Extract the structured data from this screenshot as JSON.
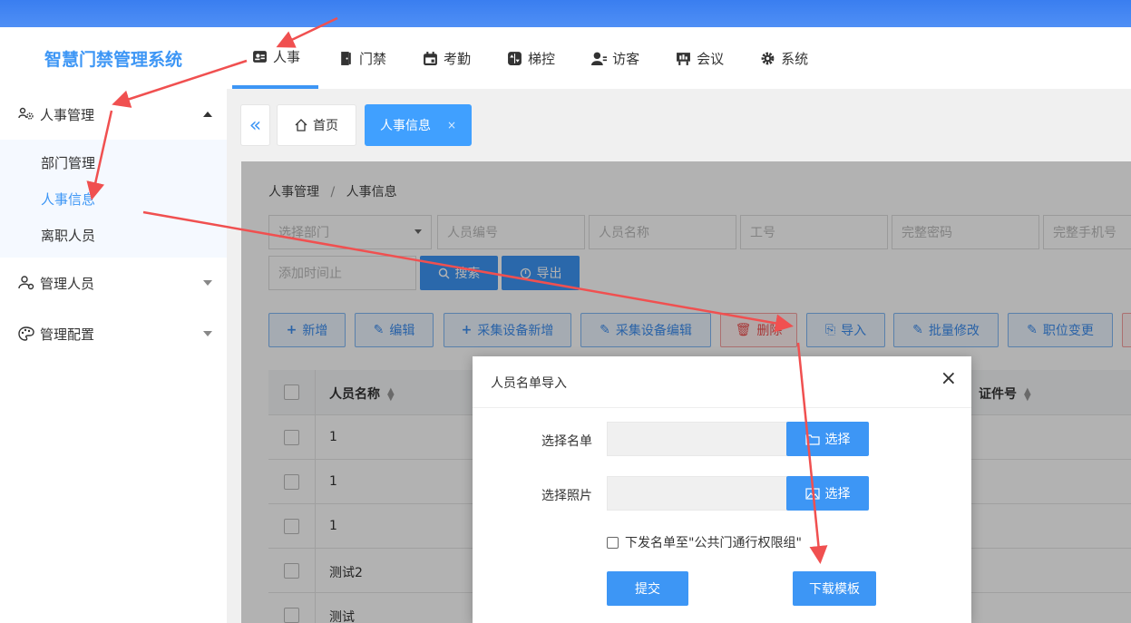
{
  "app": {
    "title": "智慧门禁管理系统"
  },
  "topnav": [
    {
      "label": "人事",
      "icon": "id-card-icon",
      "active": true
    },
    {
      "label": "门禁",
      "icon": "door-icon"
    },
    {
      "label": "考勤",
      "icon": "calendar-icon"
    },
    {
      "label": "梯控",
      "icon": "elevator-icon"
    },
    {
      "label": "访客",
      "icon": "visitor-icon"
    },
    {
      "label": "会议",
      "icon": "meeting-icon"
    },
    {
      "label": "系统",
      "icon": "gear-icon"
    }
  ],
  "sidebar": {
    "groups": [
      {
        "label": "人事管理",
        "icon": "users-gear-icon",
        "expanded": true,
        "items": [
          {
            "label": "部门管理"
          },
          {
            "label": "人事信息",
            "active": true
          },
          {
            "label": "离职人员"
          }
        ]
      },
      {
        "label": "管理人员",
        "icon": "user-admin-icon",
        "expanded": false
      },
      {
        "label": "管理配置",
        "icon": "palette-icon",
        "expanded": false
      }
    ]
  },
  "tabs": {
    "collapse": "«",
    "home": "首页",
    "active": "人事信息",
    "close": "×"
  },
  "breadcrumb": {
    "parent": "人事管理",
    "sep": "/",
    "current": "人事信息"
  },
  "filters": {
    "department_placeholder": "选择部门",
    "staff_no_placeholder": "人员编号",
    "name_placeholder": "人员名称",
    "job_no_placeholder": "工号",
    "password_placeholder": "完整密码",
    "phone_placeholder": "完整手机号",
    "added_until_placeholder": "添加时间止",
    "search_label": "搜索",
    "export_label": "导出"
  },
  "toolbar": {
    "add": "新增",
    "edit": "编辑",
    "device_add": "采集设备新增",
    "device_edit": "采集设备编辑",
    "delete": "删除",
    "import": "导入",
    "batch_edit": "批量修改",
    "position_change": "职位变更"
  },
  "table": {
    "columns": [
      "人员名称",
      "证件号"
    ],
    "rows": [
      {
        "name": "1"
      },
      {
        "name": "1"
      },
      {
        "name": "1"
      },
      {
        "name": "测试2"
      },
      {
        "name": "测试"
      }
    ]
  },
  "modal": {
    "title": "人员名单导入",
    "close": "×",
    "select_list_label": "选择名单",
    "select_photo_label": "选择照片",
    "choose_label": "选择",
    "checkbox_label": "下发名单至\"公共门通行权限组\"",
    "submit_label": "提交",
    "download_label": "下载模板"
  },
  "colors": {
    "accent": "#3d96f5",
    "topbar": "#3a7ef0",
    "arrow": "#f05050",
    "danger": "#f05050"
  }
}
